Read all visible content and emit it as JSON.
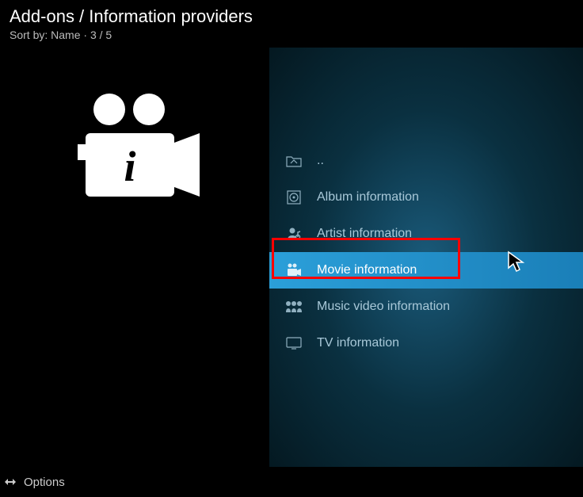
{
  "header": {
    "breadcrumb": "Add-ons / Information providers",
    "sort_label": "Sort by: Name",
    "position": "3 / 5"
  },
  "list": {
    "items": [
      {
        "icon": "folder-up",
        "label": ".."
      },
      {
        "icon": "album",
        "label": "Album information"
      },
      {
        "icon": "artist",
        "label": "Artist information"
      },
      {
        "icon": "movie",
        "label": "Movie information",
        "selected": true
      },
      {
        "icon": "music-video",
        "label": "Music video information"
      },
      {
        "icon": "tv",
        "label": "TV information"
      }
    ]
  },
  "footer": {
    "options_label": "Options"
  }
}
